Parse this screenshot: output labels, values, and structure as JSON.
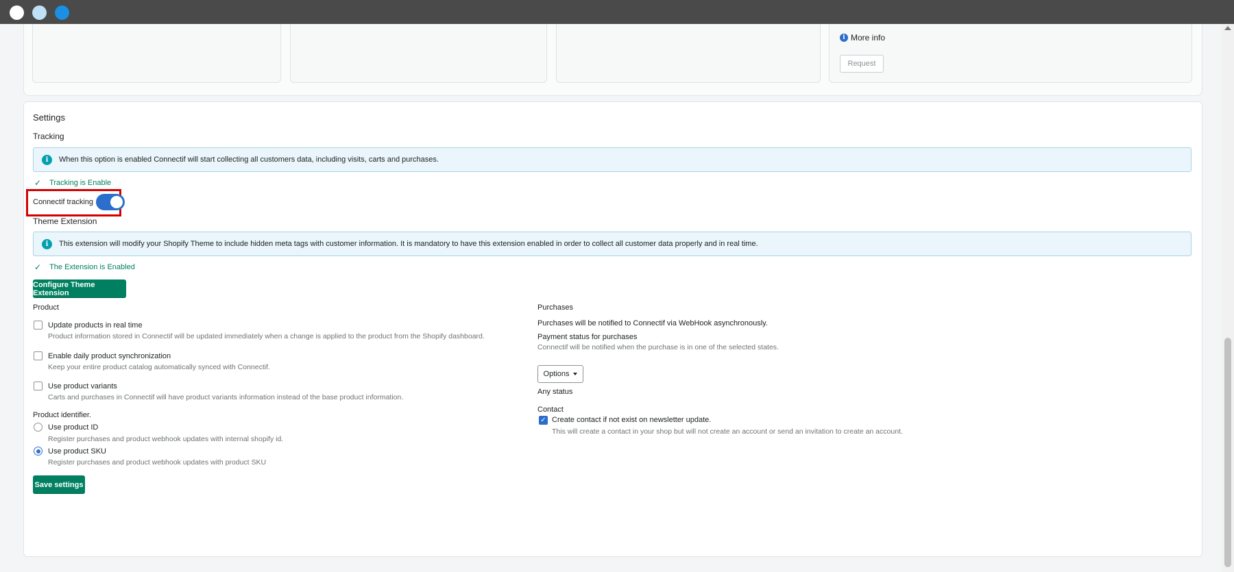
{
  "top_cards": {
    "more_info": "More info",
    "request_label": "Request"
  },
  "settings": {
    "title": "Settings",
    "tracking": {
      "heading": "Tracking",
      "banner_text": "When this option is enabled Connectif will start collecting all customers data, including visits, carts and purchases.",
      "status_prefix": "Tracking is",
      "status_value": "Enable",
      "toggle_label": "Connectif tracking",
      "toggle_on": true
    },
    "theme_extension": {
      "heading": "Theme Extension",
      "banner_text": "This extension will modify your Shopify Theme to include hidden meta tags with customer information. It is mandatory to have this extension enabled in order to collect all customer data properly and in real time.",
      "status_prefix": "The Extension is",
      "status_value": "Enabled",
      "configure_button": "Configure Theme Extension"
    },
    "product": {
      "heading": "Product",
      "options": [
        {
          "label": "Update products in real time",
          "help": "Product information stored in Connectif will be updated immediately when a change is applied to the product from the Shopify dashboard.",
          "checked": false
        },
        {
          "label": "Enable daily product synchronization",
          "help": "Keep your entire product catalog automatically synced with Connectif.",
          "checked": false
        },
        {
          "label": "Use product variants",
          "help": "Carts and purchases in Connectif will have product variants information instead of the base product information.",
          "checked": false
        }
      ],
      "identifier_heading": "Product identifier.",
      "identifiers": [
        {
          "label": "Use product ID",
          "help": "Register purchases and product webhook updates with internal shopify id.",
          "selected": false
        },
        {
          "label": "Use product SKU",
          "help": "Register purchases and product webhook updates with product SKU",
          "selected": true
        }
      ]
    },
    "purchases": {
      "heading": "Purchases",
      "description": "Purchases will be notified to Connectif via WebHook asynchronously.",
      "payment_status_label": "Payment status for purchases",
      "payment_status_help": "Connectif will be notified when the purchase is in one of the selected states.",
      "options_button": "Options",
      "selected_status": "Any status"
    },
    "contact": {
      "heading": "Contact",
      "option_label": "Create contact if not exist on newsletter update.",
      "option_help": "This will create a contact in your shop but will not create an account or send an invitation to create an account.",
      "checked": true
    },
    "save_button": "Save settings"
  },
  "colors": {
    "primary_green": "#008060",
    "toggle_blue": "#2c6ecb",
    "banner_bg": "#eaf6fb",
    "highlight_red": "#d40000"
  }
}
